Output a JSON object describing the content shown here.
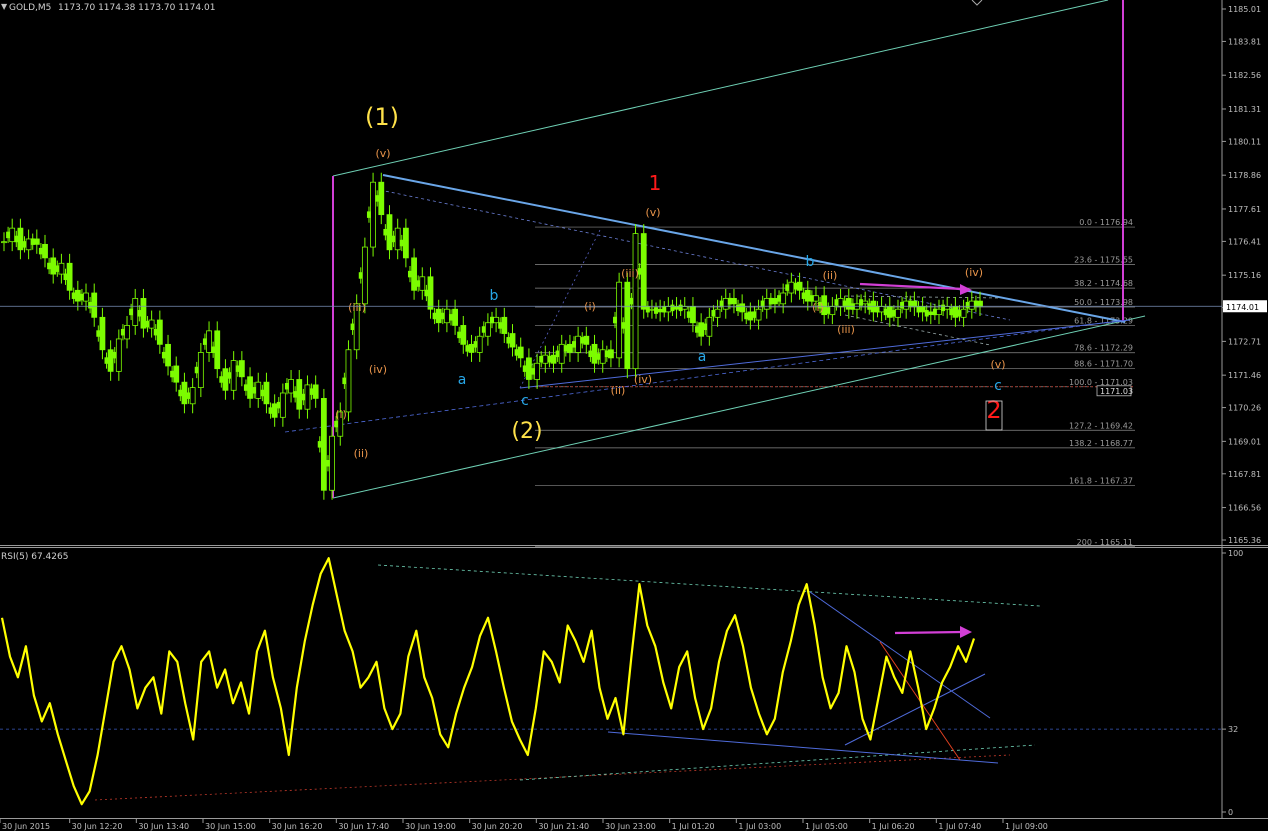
{
  "window": {
    "symbol_header": "GOLD,M5",
    "ohlc": "1173.70 1174.38 1173.70 1174.01",
    "current_price_label": "1174.01"
  },
  "colors": {
    "background": "#000000",
    "candle": "#7CFC00",
    "rsi_line": "#FFFF00",
    "wave_yellow": "#FFE24A",
    "wave_orange": "#E8944A",
    "wave_blue": "#27A7E8",
    "wave_red": "#FF1A1A",
    "magenta": "#D23FD6",
    "trend_blue": "#4F6BDB",
    "trend_cyan": "#6FD1B5",
    "fib_grey": "#8A8A8A",
    "axis_text": "#BFBFBF"
  },
  "price_axis": {
    "ticks": [
      "1185.01",
      "1183.81",
      "1182.56",
      "1181.31",
      "1180.11",
      "1178.86",
      "1177.61",
      "1176.41",
      "1175.16",
      "1173.96",
      "1172.71",
      "1171.46",
      "1170.26",
      "1169.01",
      "1167.81",
      "1166.56",
      "1165.36"
    ]
  },
  "time_axis": {
    "ticks": [
      "30 Jun 2015",
      "30 Jun 12:20",
      "30 Jun 13:40",
      "30 Jun 15:00",
      "30 Jun 16:20",
      "30 Jun 17:40",
      "30 Jun 19:00",
      "30 Jun 20:20",
      "30 Jun 21:40",
      "30 Jun 23:00",
      "1 Jul 01:20",
      "1 Jul 03:00",
      "1 Jul 05:00",
      "1 Jul 06:20",
      "1 Jul 07:40",
      "1 Jul 09:00"
    ]
  },
  "fib_levels": [
    {
      "label": "0.0 - 1176.94",
      "price": 1176.94
    },
    {
      "label": "23.6 - 1175.55",
      "price": 1175.55
    },
    {
      "label": "38.2 - 1174.68",
      "price": 1174.68
    },
    {
      "label": "50.0 - 1173.98",
      "price": 1173.98
    },
    {
      "label": "61.8 - 1173.29",
      "price": 1173.29
    },
    {
      "label": "78.6 - 1172.29",
      "price": 1172.29
    },
    {
      "label": "88.6 - 1171.70",
      "price": 1171.7
    },
    {
      "label": "100.0 - 1171.03",
      "price": 1171.03
    },
    {
      "label": "127.2 - 1169.42",
      "price": 1169.42
    },
    {
      "label": "138.2 - 1168.77",
      "price": 1168.77
    },
    {
      "label": "161.8 - 1167.37",
      "price": 1167.37
    },
    {
      "label": "200 - 1165.11",
      "price": 1165.11
    }
  ],
  "boxed_price_label": "1171.03",
  "wave_labels": [
    {
      "text": "(1)",
      "color": "wave_yellow"
    },
    {
      "text": "(2)",
      "color": "wave_yellow"
    },
    {
      "text": "1",
      "color": "wave_red"
    },
    {
      "text": "2",
      "color": "wave_red"
    },
    {
      "text": "(v)",
      "color": "wave_orange"
    },
    {
      "text": "(iii)",
      "color": "wave_orange"
    },
    {
      "text": "(iv)",
      "color": "wave_orange"
    },
    {
      "text": "(i)",
      "color": "wave_orange"
    },
    {
      "text": "(ii)",
      "color": "wave_orange"
    },
    {
      "text": "a",
      "color": "wave_blue"
    },
    {
      "text": "b",
      "color": "wave_blue"
    },
    {
      "text": "c",
      "color": "wave_blue"
    },
    {
      "text": "(i)",
      "color": "wave_orange"
    },
    {
      "text": "(iii)",
      "color": "wave_orange"
    },
    {
      "text": "(ii)",
      "color": "wave_orange"
    },
    {
      "text": "(iv)",
      "color": "wave_orange"
    },
    {
      "text": "(v)",
      "color": "wave_orange"
    },
    {
      "text": "a",
      "color": "wave_blue"
    },
    {
      "text": "b",
      "color": "wave_blue"
    },
    {
      "text": "(ii)",
      "color": "wave_orange"
    },
    {
      "text": "(i)",
      "color": "wave_orange"
    },
    {
      "text": "(iii)",
      "color": "wave_orange"
    },
    {
      "text": "(iv)",
      "color": "wave_orange"
    },
    {
      "text": "(v)",
      "color": "wave_orange"
    },
    {
      "text": "c",
      "color": "wave_blue"
    }
  ],
  "rsi": {
    "title": "RSI(5) 67.4265",
    "ticks": [
      "100",
      "32",
      "0"
    ]
  },
  "chart_data": [
    {
      "type": "candlestick",
      "title": "",
      "ylim": [
        1165.36,
        1185.01
      ],
      "grid": false,
      "series": [
        {
          "values": [
            1176.4,
            1176.9,
            1176.1,
            1176.5,
            1176.3,
            1175.8,
            1175.2,
            1175.6,
            1174.6,
            1174.2,
            1174.5,
            1173.6,
            1172.4,
            1171.6,
            1172.8,
            1173.3,
            1174.3,
            1173.2,
            1173.5,
            1172.6,
            1171.8,
            1171.2,
            1170.4,
            1171.0,
            1172.3,
            1173.1,
            1171.7,
            1170.9,
            1172.0,
            1171.4,
            1170.6,
            1171.2,
            1170.4,
            1169.9,
            1170.8,
            1171.3,
            1170.2,
            1171.1,
            1170.6,
            1167.2,
            1169.2,
            1170.1,
            1172.4,
            1174.1,
            1176.2,
            1178.6,
            1177.4,
            1176.1,
            1176.9,
            1175.8,
            1174.6,
            1175.1,
            1173.9,
            1173.4,
            1173.9,
            1173.3,
            1172.6,
            1172.3,
            1172.9,
            1173.4,
            1173.6,
            1173.0,
            1172.5,
            1172.1,
            1171.3,
            1171.9,
            1172.2,
            1171.9,
            1172.6,
            1172.3,
            1172.9,
            1172.6,
            1171.9,
            1172.4,
            1172.1,
            1174.9,
            1171.7,
            1176.7,
            1173.9,
            1173.9,
            1173.8,
            1174.0,
            1173.9,
            1174.0,
            1173.4,
            1172.9,
            1173.6,
            1173.9,
            1174.3,
            1174.1,
            1173.8,
            1173.5,
            1173.9,
            1174.3,
            1174.1,
            1174.5,
            1174.9,
            1174.6,
            1174.2,
            1174.4,
            1173.7,
            1174.0,
            1174.3,
            1173.9,
            1174.1,
            1174.2,
            1173.8,
            1174.0,
            1173.6,
            1173.9,
            1174.2,
            1174.0,
            1173.8,
            1173.7,
            1173.9,
            1174.0,
            1173.6,
            1173.9,
            1174.2,
            1174.0
          ]
        }
      ]
    },
    {
      "type": "line",
      "title": "",
      "ylim": [
        0,
        100
      ],
      "grid": false,
      "series": [
        {
          "values": [
            75,
            60,
            52,
            64,
            45,
            35,
            42,
            30,
            20,
            10,
            3,
            8,
            22,
            40,
            58,
            64,
            55,
            40,
            48,
            52,
            38,
            62,
            58,
            42,
            28,
            58,
            62,
            48,
            55,
            42,
            50,
            38,
            62,
            70,
            52,
            40,
            22,
            48,
            66,
            80,
            92,
            98,
            84,
            70,
            62,
            48,
            52,
            58,
            40,
            32,
            38,
            60,
            70,
            52,
            44,
            30,
            25,
            38,
            48,
            56,
            68,
            75,
            62,
            48,
            35,
            28,
            22,
            40,
            62,
            58,
            50,
            72,
            66,
            58,
            70,
            48,
            36,
            44,
            30,
            60,
            88,
            72,
            64,
            50,
            40,
            56,
            62,
            44,
            32,
            40,
            58,
            70,
            76,
            64,
            48,
            38,
            30,
            36,
            54,
            66,
            80,
            88,
            72,
            52,
            40,
            46,
            64,
            54,
            36,
            28,
            44,
            60,
            52,
            46,
            62,
            48,
            32,
            40,
            50,
            56,
            64,
            58,
            67
          ]
        }
      ]
    }
  ]
}
